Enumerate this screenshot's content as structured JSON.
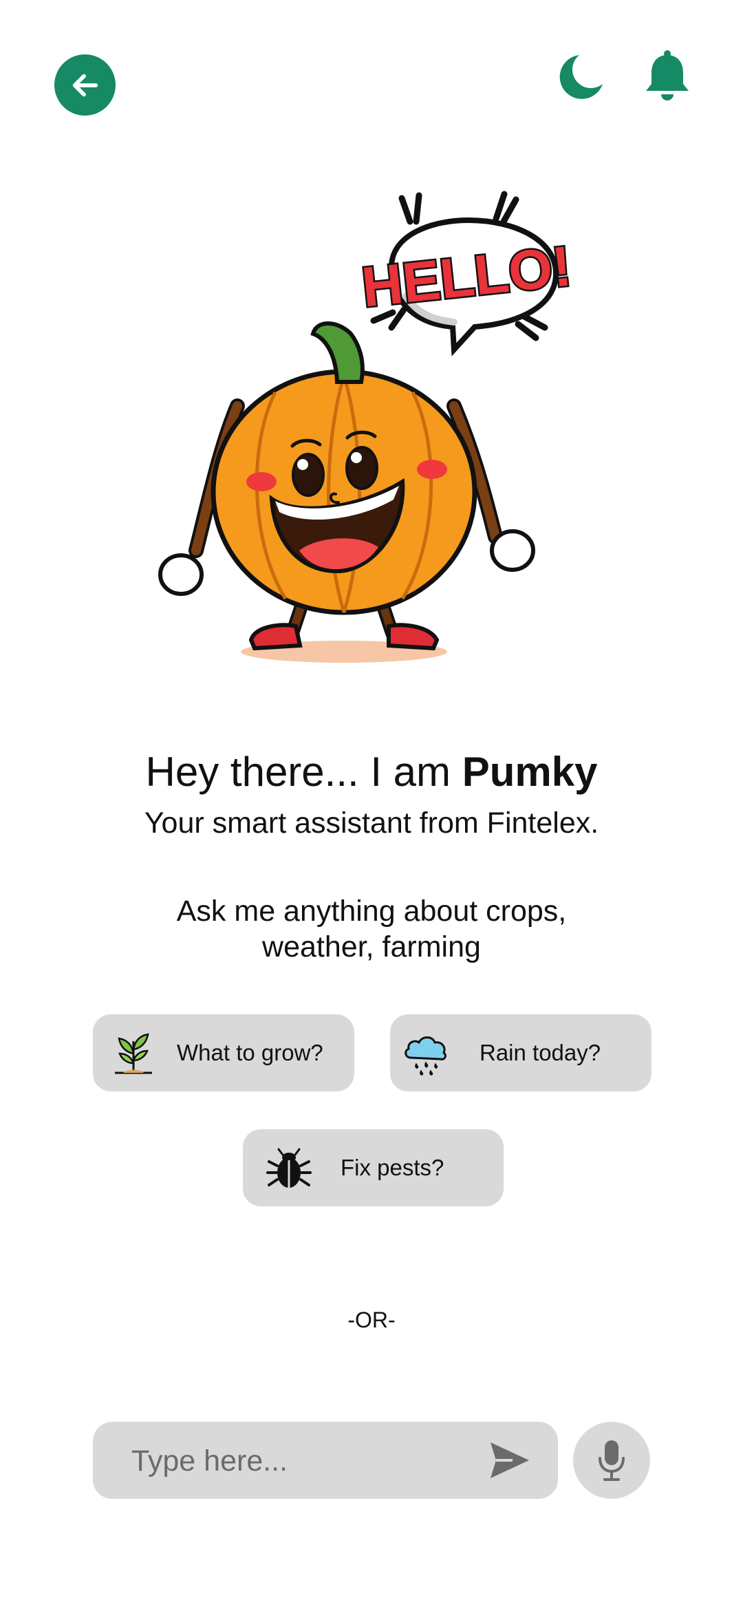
{
  "colors": {
    "brand_green": "#158a64",
    "chip_background": "#d9d9d9",
    "text": "#111111"
  },
  "header": {
    "back_icon": "arrow-left-icon",
    "theme_icon": "moon-icon",
    "notifications_icon": "bell-icon"
  },
  "mascot": {
    "speech_bubble_text": "HELLO!"
  },
  "intro": {
    "greeting_prefix": "Hey there... I am ",
    "assistant_name": "Pumky",
    "subtitle": "Your smart assistant from Fintelex.",
    "prompt_line1": "Ask me anything about crops,",
    "prompt_line2": "weather, farming"
  },
  "suggestions": [
    {
      "label": "What to grow?",
      "icon": "sprout-icon"
    },
    {
      "label": "Rain today?",
      "icon": "rain-cloud-icon"
    },
    {
      "label": "Fix pests?",
      "icon": "bug-icon"
    }
  ],
  "divider_text": "-OR-",
  "composer": {
    "placeholder": "Type here...",
    "value": "",
    "send_icon": "send-icon",
    "mic_icon": "microphone-icon"
  }
}
